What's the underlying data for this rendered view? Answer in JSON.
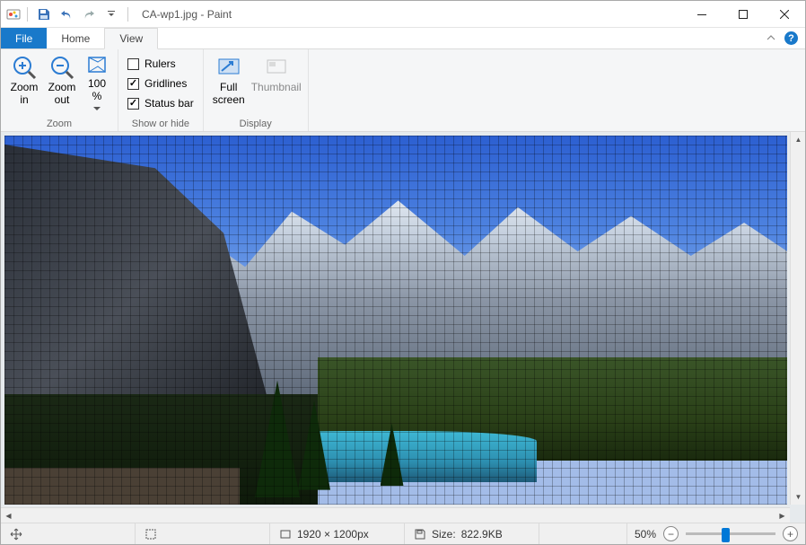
{
  "title": {
    "filename": "CA-wp1.jpg",
    "app": "Paint"
  },
  "tabs": {
    "file": "File",
    "home": "Home",
    "view": "View"
  },
  "ribbon": {
    "zoom": {
      "zoom_in": "Zoom\nin",
      "zoom_out": "Zoom\nout",
      "pct_100": "100\n%",
      "group_label": "Zoom"
    },
    "show_hide": {
      "rulers": "Rulers",
      "gridlines": "Gridlines",
      "statusbar": "Status bar",
      "group_label": "Show or hide",
      "rulers_checked": false,
      "gridlines_checked": true,
      "statusbar_checked": true
    },
    "display": {
      "full_screen": "Full\nscreen",
      "thumbnail": "Thumbnail",
      "group_label": "Display"
    }
  },
  "status": {
    "dimensions": "1920 × 1200px",
    "size_label": "Size:",
    "size_value": "822.9KB",
    "zoom_pct": "50%"
  }
}
